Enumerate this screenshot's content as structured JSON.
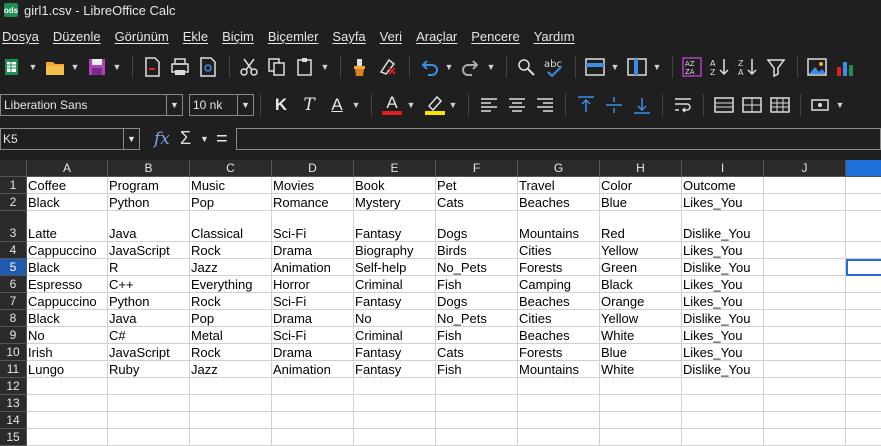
{
  "window": {
    "title": "girl1.csv - LibreOffice Calc",
    "app_icon_label": "ods"
  },
  "menu": [
    "Dosya",
    "Düzenle",
    "Görünüm",
    "Ekle",
    "Biçim",
    "Biçemler",
    "Sayfa",
    "Veri",
    "Araçlar",
    "Pencere",
    "Yardım"
  ],
  "toolbar": {
    "font_name": "Liberation Sans",
    "font_size": "10 nk",
    "bold_label": "K",
    "italic_label": "T",
    "underline_label": "A",
    "font_color_label": "A",
    "colors": {
      "font_color": "#e02020",
      "highlight_color": "#f5e500",
      "accent": "#1e6fd9"
    }
  },
  "formula_bar": {
    "cell_ref": "K5",
    "fx_label": "fx",
    "sigma_label": "Σ",
    "equals_label": "=",
    "content": ""
  },
  "sheet": {
    "columns": [
      "A",
      "B",
      "C",
      "D",
      "E",
      "F",
      "G",
      "H",
      "I",
      "J"
    ],
    "selected_column": "K",
    "active_row": 5,
    "rows": [
      {
        "num": "1",
        "cells": [
          "Coffee",
          "Program",
          "Music",
          "Movies",
          "Book",
          "Pet",
          "Travel",
          "Color",
          "Outcome"
        ]
      },
      {
        "num": "2",
        "cells": [
          "Black",
          "Python",
          "Pop",
          "Romance",
          "Mystery",
          "Cats",
          "Beaches",
          "Blue",
          "Likes_You"
        ]
      },
      {
        "num": "3",
        "cells": [
          "Latte",
          "Java",
          "Classical",
          "Sci-Fi",
          "Fantasy",
          "Dogs",
          "Mountains",
          "Red",
          "Dislike_You"
        ]
      },
      {
        "num": "4",
        "cells": [
          "Cappuccino",
          "JavaScript",
          "Rock",
          "Drama",
          "Biography",
          "Birds",
          "Cities",
          "Yellow",
          "Likes_You"
        ]
      },
      {
        "num": "5",
        "cells": [
          "Black",
          "R",
          "Jazz",
          "Animation",
          "Self-help",
          "No_Pets",
          "Forests",
          "Green",
          "Dislike_You"
        ]
      },
      {
        "num": "6",
        "cells": [
          "Espresso",
          "C++",
          "Everything",
          "Horror",
          "Criminal",
          "Fish",
          "Camping",
          "Black",
          "Likes_You"
        ]
      },
      {
        "num": "7",
        "cells": [
          "Cappuccino",
          "Python",
          "Rock",
          "Sci-Fi",
          "Fantasy",
          "Dogs",
          "Beaches",
          "Orange",
          "Likes_You"
        ]
      },
      {
        "num": "8",
        "cells": [
          "Black",
          "Java",
          "Pop",
          "Drama",
          "No",
          "No_Pets",
          "Cities",
          "Yellow",
          "Dislike_You"
        ]
      },
      {
        "num": "9",
        "cells": [
          "No",
          "C#",
          "Metal",
          "Sci-Fi",
          "Criminal",
          "Fish",
          "Beaches",
          "White",
          "Likes_You"
        ]
      },
      {
        "num": "10",
        "cells": [
          "Irish",
          "JavaScript",
          "Rock",
          "Drama",
          "Fantasy",
          "Cats",
          "Forests",
          "Blue",
          "Likes_You"
        ]
      },
      {
        "num": "11",
        "cells": [
          "Lungo",
          "Ruby",
          "Jazz",
          "Animation",
          "Fantasy",
          "Fish",
          "Mountains",
          "White",
          "Dislike_You"
        ]
      },
      {
        "num": "12",
        "cells": []
      },
      {
        "num": "13",
        "cells": []
      },
      {
        "num": "14",
        "cells": []
      },
      {
        "num": "15",
        "cells": []
      }
    ]
  }
}
